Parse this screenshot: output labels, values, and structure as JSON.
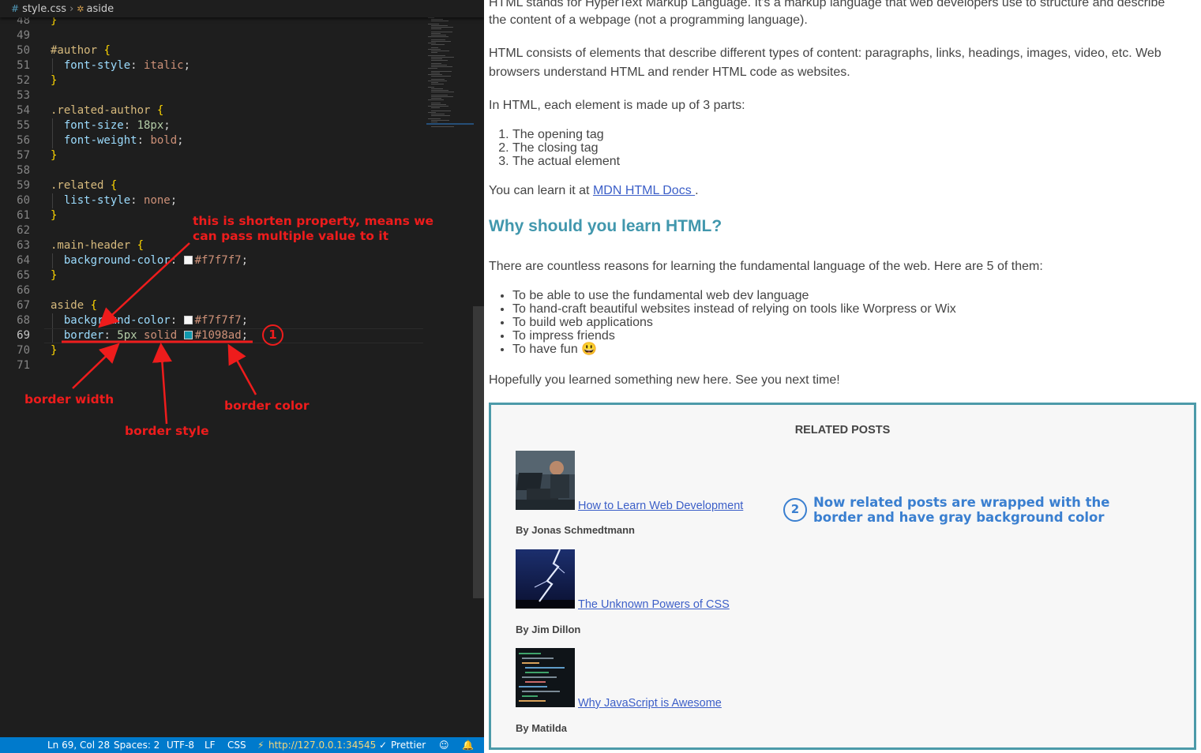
{
  "editor": {
    "breadcrumb": {
      "file": "style.css",
      "symbol": "aside"
    },
    "lines": [
      {
        "n": "48",
        "html": "<span class='brace'>}</span>"
      },
      {
        "n": "49",
        "html": ""
      },
      {
        "n": "50",
        "html": "<span class='sel'>#author</span> <span class='brace'>{</span>"
      },
      {
        "n": "51",
        "html": "  <span class='prop'>font-style</span>: <span class='val'>italic</span>;"
      },
      {
        "n": "52",
        "html": "<span class='brace'>}</span>"
      },
      {
        "n": "53",
        "html": ""
      },
      {
        "n": "54",
        "html": "<span class='sel'>.related-author</span> <span class='brace'>{</span>"
      },
      {
        "n": "55",
        "html": "  <span class='prop'>font-size</span>: <span class='num'>18px</span>;"
      },
      {
        "n": "56",
        "html": "  <span class='prop'>font-weight</span>: <span class='val'>bold</span>;"
      },
      {
        "n": "57",
        "html": "<span class='brace'>}</span>"
      },
      {
        "n": "58",
        "html": ""
      },
      {
        "n": "59",
        "html": "<span class='sel'>.related</span> <span class='brace'>{</span>"
      },
      {
        "n": "60",
        "html": "  <span class='prop'>list-style</span>: <span class='val'>none</span>;"
      },
      {
        "n": "61",
        "html": "<span class='brace'>}</span>"
      },
      {
        "n": "62",
        "html": ""
      },
      {
        "n": "63",
        "html": "<span class='sel'>.main-header</span> <span class='brace'>{</span>"
      },
      {
        "n": "64",
        "html": "  <span class='prop'>background-color</span>: <span class='swatch' style='background:#f7f7f7'></span><span class='val'>#f7f7f7</span>;"
      },
      {
        "n": "65",
        "html": "<span class='brace'>}</span>"
      },
      {
        "n": "66",
        "html": ""
      },
      {
        "n": "67",
        "html": "<span class='sel'>aside</span> <span class='brace'>{</span>"
      },
      {
        "n": "68",
        "html": "  <span class='prop'>background-color</span>: <span class='swatch' style='background:#f7f7f7'></span><span class='val'>#f7f7f7</span>;"
      },
      {
        "n": "69",
        "html": "  <span class='prop'>border</span>: <span class='num'>5px</span> <span class='val'>solid</span> <span class='swatch' style='background:#1098ad'></span><span class='val'>#1098ad</span>;"
      },
      {
        "n": "70",
        "html": "<span class='brace'>}</span>"
      },
      {
        "n": "71",
        "html": ""
      }
    ],
    "active_line": "69",
    "annotations": {
      "shorthand_line1": "this is shorten property, means we",
      "shorthand_line2": "can pass multiple value to it",
      "border_width": "border width",
      "border_style": "border style",
      "border_color": "border color",
      "step1": "1"
    },
    "statusbar": {
      "position": "Ln 69, Col 28",
      "spaces": "Spaces: 2",
      "encoding": "UTF-8",
      "eol": "LF",
      "language": "CSS",
      "live_server": "http://127.0.0.1:34545",
      "prettier": "Prettier"
    }
  },
  "browser": {
    "para_intro_1": "HTML stands for HyperText Markup Language. It's a markup language that web developers use to structure and describe",
    "para_intro_2": "the content of a webpage (not a programming language).",
    "para_elements_1": "HTML consists of elements that describe different types of content: paragraphs, links, headings, images, video, etc. Web",
    "para_elements_2": "browsers understand HTML and render HTML code as websites.",
    "para_parts": "In HTML, each element is made up of 3 parts:",
    "parts": [
      "The opening tag",
      "The closing tag",
      "The actual element"
    ],
    "learn_prefix": "You can learn it at ",
    "learn_link": "MDN HTML Docs ",
    "learn_suffix": ".",
    "heading": "Why should you learn HTML?",
    "para_reasons": "There are countless reasons for learning the fundamental language of the web. Here are 5 of them:",
    "reasons": [
      "To be able to use the fundamental web dev language",
      "To hand-craft beautiful websites instead of relying on tools like Worpress or Wix",
      "To build web applications",
      "To impress friends",
      "To have fun 😃"
    ],
    "closing": "Hopefully you learned something new here. See you next time!",
    "aside": {
      "title": "RELATED POSTS",
      "posts": [
        {
          "link": "How to Learn Web Development",
          "author": "By Jonas Schmedtmann"
        },
        {
          "link": "The Unknown Powers of CSS",
          "author": "By Jim Dillon"
        },
        {
          "link": "Why JavaScript is Awesome",
          "author": "By Matilda"
        }
      ],
      "note_number": "2",
      "note_line1": "Now related posts are wrapped with the",
      "note_line2": "border and have gray background color"
    }
  },
  "colors": {
    "aside_border": "#1098ad",
    "aside_bg": "#f7f7f7",
    "heading": "#4197ad",
    "annotation_red": "#ee1c1c",
    "annotation_blue": "#3a7fd0",
    "statusbar": "#007acc"
  }
}
